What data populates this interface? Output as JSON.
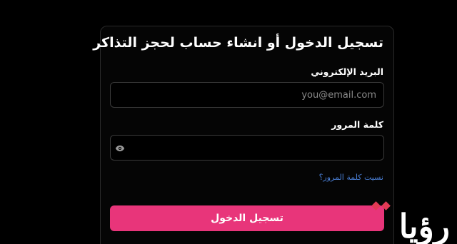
{
  "form": {
    "title": "تسجيل الدخول أو انشاء حساب لحجز التذاكر",
    "email_label": "البريد الإلكتروني",
    "email_placeholder": "you@email.com",
    "email_value": "",
    "password_label": "كلمة المرور",
    "password_value": "",
    "forgot_link": "نسيت كلمة المرور؟",
    "submit_label": "تسجيل الدخول"
  },
  "watermark": {
    "text": "رؤيا",
    "dot_color": "#e23a55"
  },
  "colors": {
    "background": "#000000",
    "accent": "#e8357a",
    "link": "#4a7fd6"
  },
  "icons": {
    "password_toggle": "eye-icon"
  }
}
